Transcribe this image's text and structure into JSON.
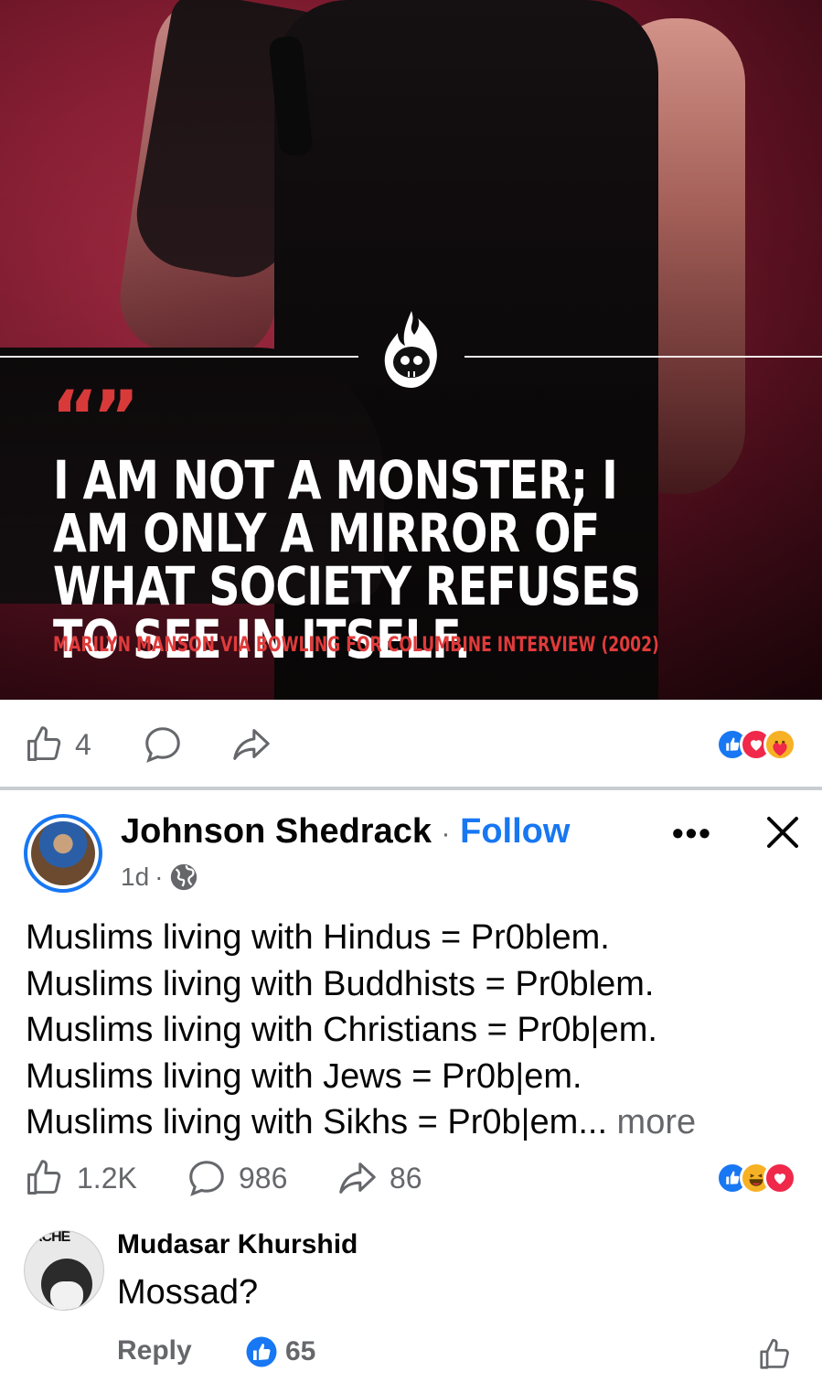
{
  "hero": {
    "quote_mark": "“”",
    "quote": "I AM NOT A MONSTER; I AM ONLY A MIRROR OF WHAT SOCIETY REFUSES TO SEE IN ITSELF.",
    "attribution": "MARILYN MANSON VIA BOWLING FOR COLUMBINE INTERVIEW (2002)",
    "badge_icon": "flaming-skull-icon"
  },
  "post1_actions": {
    "like_count": "4",
    "reactions": [
      "like",
      "love",
      "care"
    ]
  },
  "post2": {
    "author": "Johnson Shedrack",
    "separator": "·",
    "follow_label": "Follow",
    "time": "1d",
    "meta_separator": "·",
    "audience_icon": "globe-icon",
    "text_lines": [
      "Muslims living with Hindus = Pr0blem.",
      "Muslims living with Buddhists = Pr0blem.",
      "Muslims living with Christians = Pr0b|em.",
      "Muslims living with Jews = Pr0b|em.",
      "Muslims living with Sikhs = Pr0b|em..."
    ],
    "more_label": " more",
    "like_count": "1.2K",
    "comment_count": "986",
    "share_count": "86",
    "reactions": [
      "like",
      "haha",
      "love"
    ]
  },
  "comment": {
    "avatar_text": "ACHE",
    "author": "Mudasar Khurshid",
    "text": "Mossad?",
    "reply_label": "Reply",
    "like_count": "65"
  },
  "colors": {
    "accent": "#1877f2",
    "secondary_text": "#65676b",
    "quote_red": "#d83a3a"
  }
}
